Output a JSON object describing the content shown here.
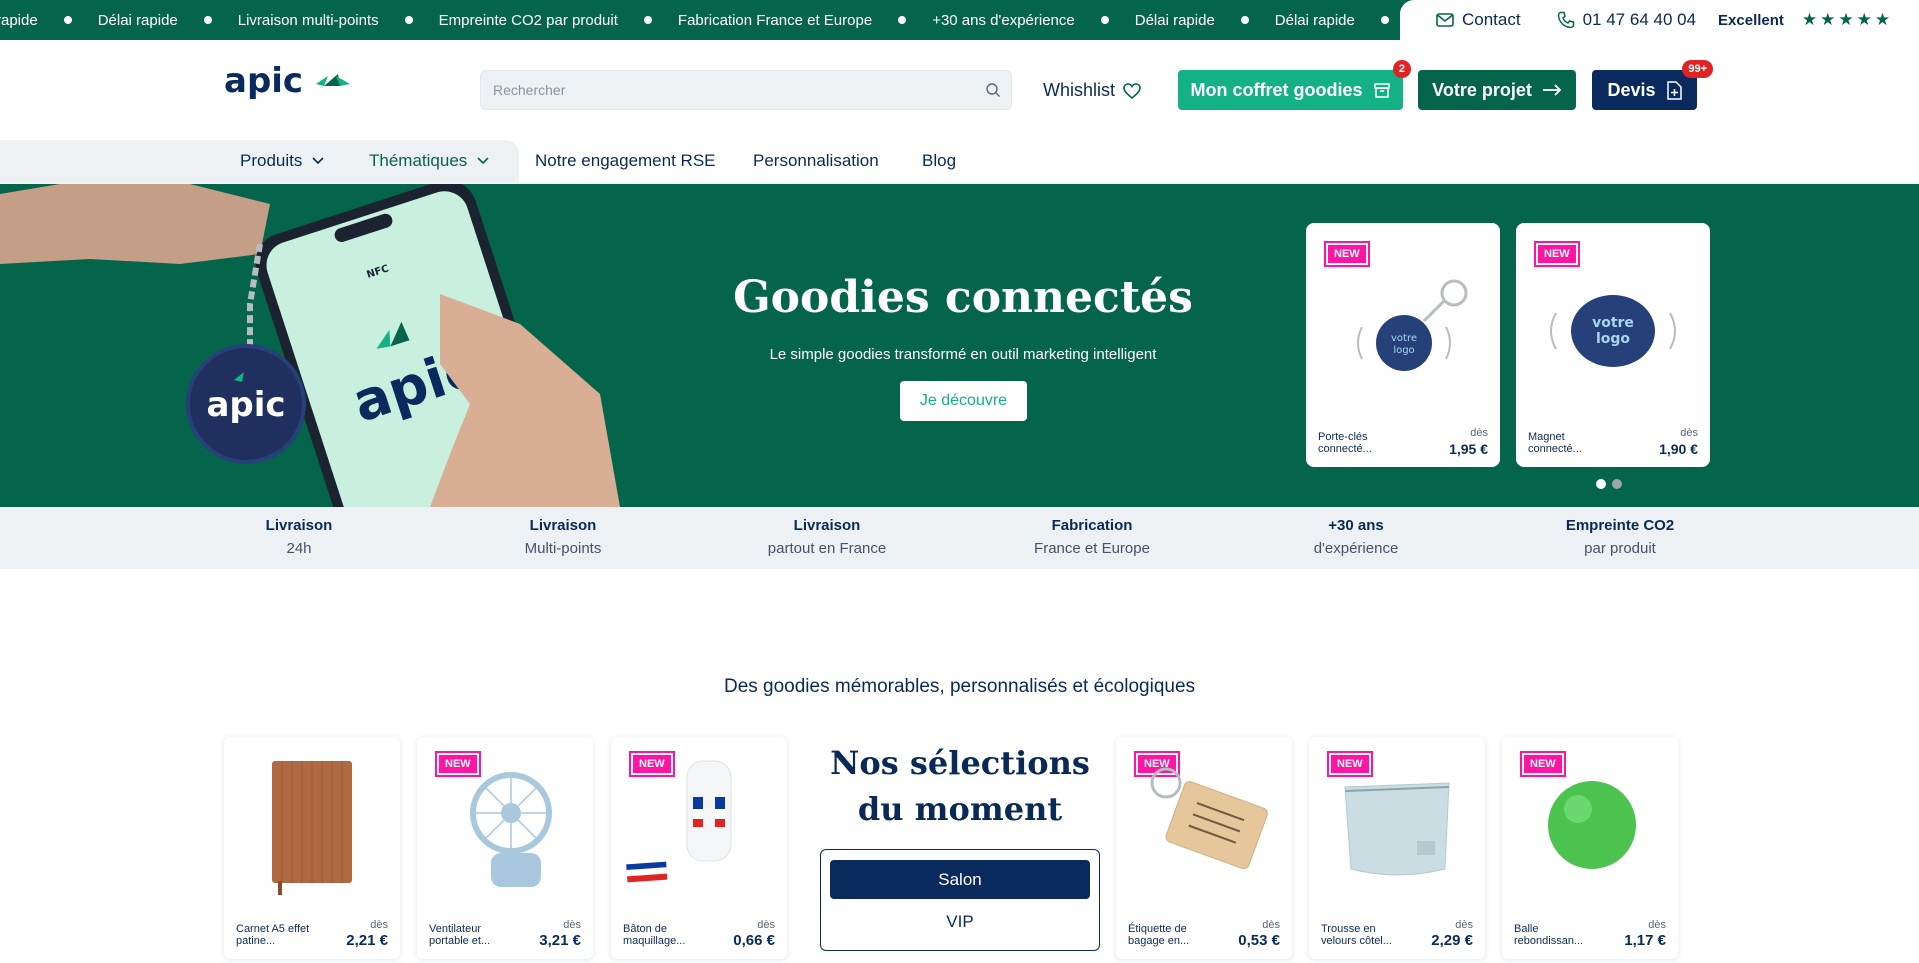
{
  "ticker": {
    "items": [
      "rapide",
      "Délai rapide",
      "Livraison multi-points",
      "Empreinte CO2 par produit",
      "Fabrication France et Europe",
      "+30 ans d'expérience",
      "Délai rapide",
      "Délai rapide"
    ],
    "contact_label": "Contact",
    "phone": "01 47 64 40 04",
    "rating_label": "Excellent",
    "stars": "★★★★★"
  },
  "header": {
    "search_placeholder": "Rechercher",
    "wishlist_label": "Whishlist",
    "coffret_label": "Mon coffret goodies",
    "coffret_badge": "2",
    "projet_label": "Votre projet",
    "devis_label": "Devis",
    "devis_badge": "99+"
  },
  "nav": {
    "produits": "Produits",
    "thematiques": "Thématiques",
    "rse": "Notre engagement RSE",
    "perso": "Personnalisation",
    "blog": "Blog"
  },
  "hero": {
    "title": "Goodies connectés",
    "subtitle": "Le simple goodies transformé en outil marketing intelligent",
    "cta": "Je découvre",
    "cards": [
      {
        "new": "NEW",
        "name": "Porte-clés connecté...",
        "des": "dès",
        "price": "1,95 €"
      },
      {
        "new": "NEW",
        "name": "Magnet connecté...",
        "des": "dès",
        "price": "1,90 €"
      }
    ]
  },
  "features": [
    {
      "title": "Livraison",
      "sub": "24h"
    },
    {
      "title": "Livraison",
      "sub": "Multi-points"
    },
    {
      "title": "Livraison",
      "sub": "partout en France"
    },
    {
      "title": "Fabrication",
      "sub": "France et Europe"
    },
    {
      "title": "+30 ans",
      "sub": "d'expérience"
    },
    {
      "title": "Empreinte CO2",
      "sub": "par produit"
    }
  ],
  "section": {
    "title": "Des goodies mémorables, personnalisés et écologiques",
    "selection_title": "Nos sélections du moment",
    "selection_active": "Salon",
    "selection_other": "VIP"
  },
  "products": [
    {
      "new": "",
      "name": "Carnet A5 effet patine...",
      "des": "dès",
      "price": "2,21 €"
    },
    {
      "new": "NEW",
      "name": "Ventilateur portable et...",
      "des": "dès",
      "price": "3,21 €"
    },
    {
      "new": "NEW",
      "name": "Bâton de maquillage...",
      "des": "dès",
      "price": "0,66 €"
    },
    {
      "new": "NEW",
      "name": "Étiquette de bagage en...",
      "des": "dès",
      "price": "0,53 €"
    },
    {
      "new": "NEW",
      "name": "Trousse en velours côtel...",
      "des": "dès",
      "price": "2,29 €"
    },
    {
      "new": "NEW",
      "name": "Balle rebondissan...",
      "des": "dès",
      "price": "1,17 €"
    }
  ],
  "colors": {
    "brand_green": "#05654b",
    "accent_green": "#13b185",
    "navy": "#0a2a5e",
    "new_pink": "#ff14a5"
  }
}
